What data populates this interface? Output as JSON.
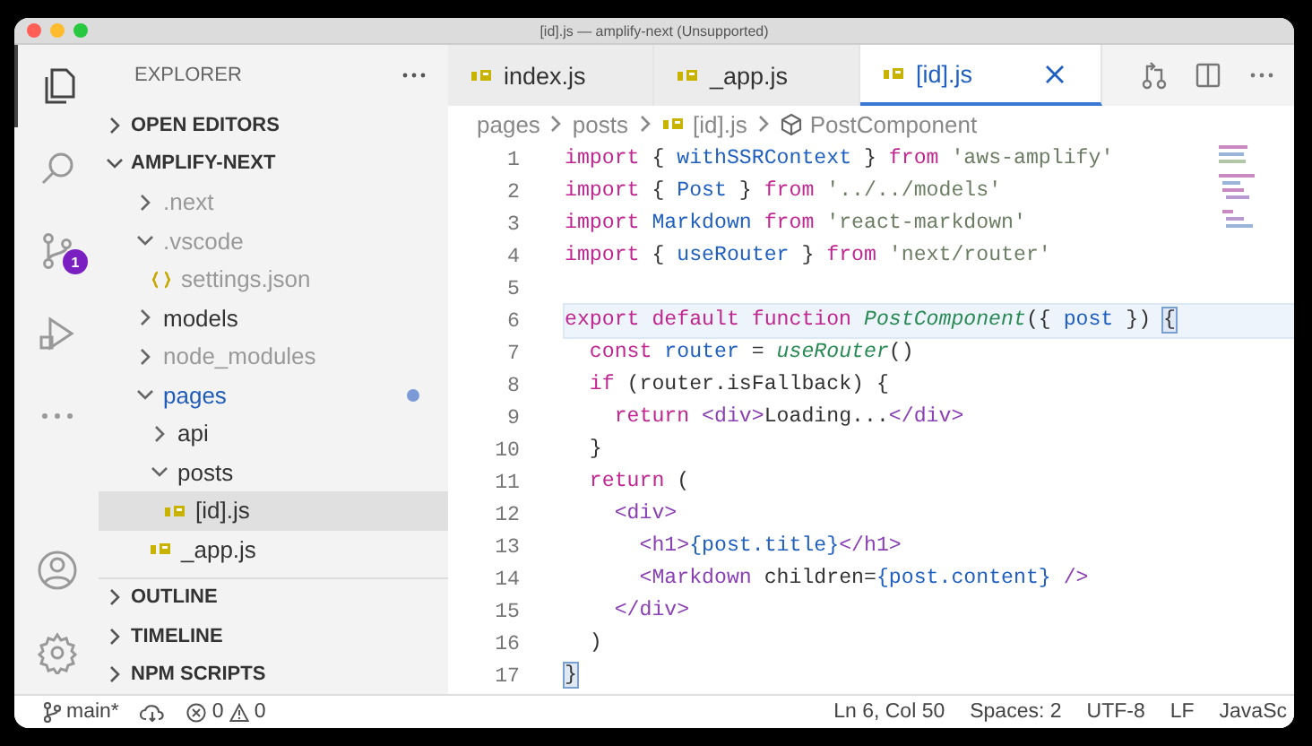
{
  "window": {
    "title": "[id].js — amplify-next (Unsupported)"
  },
  "activity_bar": {
    "items": [
      {
        "kind": "files",
        "selected": true
      },
      {
        "kind": "search",
        "selected": false
      },
      {
        "kind": "source-control",
        "selected": false,
        "badge": "1"
      },
      {
        "kind": "run",
        "selected": false
      },
      {
        "kind": "more",
        "selected": false
      },
      {
        "kind": "account",
        "selected": false
      },
      {
        "kind": "settings",
        "selected": false
      }
    ]
  },
  "sidebar": {
    "title": "EXPLORER",
    "sections": [
      {
        "title": "OPEN EDITORS",
        "expanded": false
      },
      {
        "title": "AMPLIFY-NEXT",
        "expanded": true,
        "children": [
          {
            "label": ".next",
            "kind": "folder",
            "expanded": false,
            "dimmed": true,
            "modified": false,
            "selected": false
          },
          {
            "label": ".vscode",
            "kind": "folder",
            "expanded": true,
            "dimmed": true,
            "modified": false,
            "selected": false,
            "children": [
              {
                "label": "settings.json",
                "kind": "json",
                "dimmed": true,
                "modified": false,
                "selected": false
              }
            ]
          },
          {
            "label": "models",
            "kind": "folder",
            "expanded": false,
            "dimmed": false,
            "modified": false,
            "selected": false
          },
          {
            "label": "node_modules",
            "kind": "folder",
            "expanded": false,
            "dimmed": true,
            "modified": false,
            "selected": false
          },
          {
            "label": "pages",
            "kind": "folder",
            "expanded": true,
            "dimmed": false,
            "modified": true,
            "selected": false,
            "children": [
              {
                "label": "api",
                "kind": "folder",
                "expanded": false,
                "dimmed": false,
                "modified": false,
                "selected": false
              },
              {
                "label": "posts",
                "kind": "folder",
                "expanded": true,
                "dimmed": false,
                "modified": false,
                "selected": false,
                "children": [
                  {
                    "label": "[id].js",
                    "kind": "js",
                    "dimmed": false,
                    "modified": false,
                    "selected": true
                  }
                ]
              },
              {
                "label": "_app.js",
                "kind": "js",
                "dimmed": false,
                "modified": false,
                "selected": false
              }
            ]
          }
        ]
      },
      {
        "title": "OUTLINE",
        "expanded": false
      },
      {
        "title": "TIMELINE",
        "expanded": false
      },
      {
        "title": "NPM SCRIPTS",
        "expanded": false
      }
    ]
  },
  "tabs": [
    {
      "label": "index.js",
      "kind": "js",
      "selected": false
    },
    {
      "label": "_app.js",
      "kind": "js",
      "selected": false
    },
    {
      "label": "[id].js",
      "kind": "js",
      "selected": true
    }
  ],
  "breadcrumbs": [
    {
      "label": "pages",
      "kind": "folder"
    },
    {
      "label": "posts",
      "kind": "folder"
    },
    {
      "label": "[id].js",
      "kind": "js"
    },
    {
      "label": "PostComponent",
      "kind": "symbol"
    }
  ],
  "code": {
    "lines": [
      {
        "number": "1",
        "current": false,
        "tokens": [
          {
            "kind": "keyword",
            "text": "import"
          },
          {
            "kind": "plain",
            "text": " { "
          },
          {
            "kind": "variable",
            "text": "withSSRContext"
          },
          {
            "kind": "plain",
            "text": " } "
          },
          {
            "kind": "keyword",
            "text": "from"
          },
          {
            "kind": "string",
            "text": " 'aws-amplify'"
          }
        ]
      },
      {
        "number": "2",
        "current": false,
        "tokens": [
          {
            "kind": "keyword",
            "text": "import"
          },
          {
            "kind": "plain",
            "text": " { "
          },
          {
            "kind": "variable",
            "text": "Post"
          },
          {
            "kind": "plain",
            "text": " } "
          },
          {
            "kind": "keyword",
            "text": "from"
          },
          {
            "kind": "string",
            "text": " '../../models'"
          }
        ]
      },
      {
        "number": "3",
        "current": false,
        "tokens": [
          {
            "kind": "keyword",
            "text": "import"
          },
          {
            "kind": "variable",
            "text": " Markdown"
          },
          {
            "kind": "keyword",
            "text": " from"
          },
          {
            "kind": "string",
            "text": " 'react-markdown'"
          }
        ]
      },
      {
        "number": "4",
        "current": false,
        "tokens": [
          {
            "kind": "keyword",
            "text": "import"
          },
          {
            "kind": "plain",
            "text": " { "
          },
          {
            "kind": "variable",
            "text": "useRouter"
          },
          {
            "kind": "plain",
            "text": " } "
          },
          {
            "kind": "keyword",
            "text": "from"
          },
          {
            "kind": "string",
            "text": " 'next/router'"
          }
        ]
      },
      {
        "number": "5",
        "current": false
      },
      {
        "number": "6",
        "current": true,
        "tokens": [
          {
            "kind": "keyword",
            "text": "export default function"
          },
          {
            "kind": "function",
            "text": " PostComponent"
          },
          {
            "kind": "plain",
            "text": "({ "
          },
          {
            "kind": "variable",
            "text": "post"
          },
          {
            "kind": "plain",
            "text": " }) "
          },
          {
            "kind": "bracket-match",
            "text": "{"
          }
        ]
      },
      {
        "number": "7",
        "current": false,
        "tokens": [
          {
            "kind": "keyword",
            "text": "  const"
          },
          {
            "kind": "variable",
            "text": " router"
          },
          {
            "kind": "plain",
            "text": " = "
          },
          {
            "kind": "function",
            "text": "useRouter"
          },
          {
            "kind": "plain",
            "text": "()"
          }
        ]
      },
      {
        "number": "8",
        "current": false,
        "tokens": [
          {
            "kind": "keyword",
            "text": "  if"
          },
          {
            "kind": "plain",
            "text": " (router.isFallback) {"
          }
        ]
      },
      {
        "number": "9",
        "current": false,
        "tokens": [
          {
            "kind": "keyword",
            "text": "    return"
          },
          {
            "kind": "tag",
            "text": " <div>"
          },
          {
            "kind": "plain",
            "text": "Loading..."
          },
          {
            "kind": "tag",
            "text": "</div>"
          }
        ]
      },
      {
        "number": "10",
        "current": false,
        "tokens": [
          {
            "kind": "plain",
            "text": "  }"
          }
        ]
      },
      {
        "number": "11",
        "current": false,
        "tokens": [
          {
            "kind": "keyword",
            "text": "  return"
          },
          {
            "kind": "plain",
            "text": " ("
          }
        ]
      },
      {
        "number": "12",
        "current": false,
        "tokens": [
          {
            "kind": "tag",
            "text": "    <div>"
          }
        ]
      },
      {
        "number": "13",
        "current": false,
        "tokens": [
          {
            "kind": "tag",
            "text": "      <h1>"
          },
          {
            "kind": "variable",
            "text": "{post.title}"
          },
          {
            "kind": "tag",
            "text": "</h1>"
          }
        ]
      },
      {
        "number": "14",
        "current": false,
        "tokens": [
          {
            "kind": "tag",
            "text": "      <Markdown"
          },
          {
            "kind": "plain",
            "text": " children="
          },
          {
            "kind": "variable",
            "text": "{post.content}"
          },
          {
            "kind": "tag",
            "text": " />"
          }
        ]
      },
      {
        "number": "15",
        "current": false,
        "tokens": [
          {
            "kind": "tag",
            "text": "    </div>"
          }
        ]
      },
      {
        "number": "16",
        "current": false,
        "tokens": [
          {
            "kind": "plain",
            "text": "  )"
          }
        ]
      },
      {
        "number": "17",
        "current": false,
        "tokens": [
          {
            "kind": "bracket-match",
            "text": "}"
          }
        ]
      }
    ]
  },
  "status_bar": {
    "branch": "main*",
    "errors": "0",
    "warnings": "0",
    "items": [
      "Ln 6, Col 50",
      "Spaces: 2",
      "UTF-8",
      "LF",
      "JavaSc"
    ]
  }
}
